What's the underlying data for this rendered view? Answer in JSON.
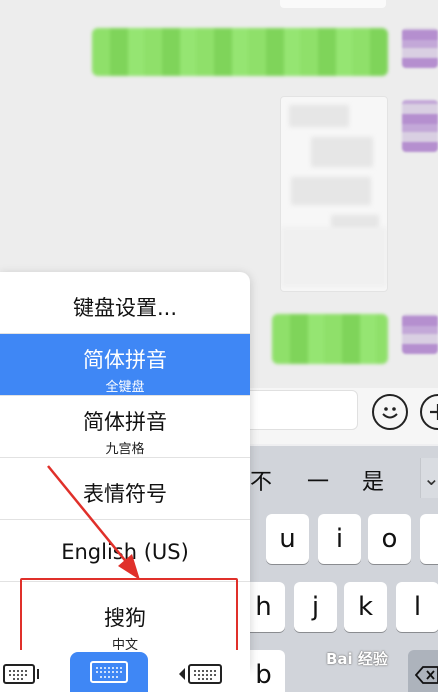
{
  "menu": {
    "items": [
      {
        "main": "键盘设置...",
        "sub": ""
      },
      {
        "main": "简体拼音",
        "sub": "全键盘",
        "selected": true
      },
      {
        "main": "简体拼音",
        "sub": "九宫格"
      },
      {
        "main": "表情符号",
        "sub": ""
      },
      {
        "main": "English (US)",
        "sub": ""
      },
      {
        "main": "搜狗",
        "sub": "中文"
      }
    ]
  },
  "keyboard": {
    "candidates": [
      "不",
      "一",
      "是"
    ],
    "row1": [
      "u",
      "i",
      "o"
    ],
    "row2": [
      "h",
      "j",
      "k",
      "l"
    ],
    "row3": [
      "b"
    ]
  },
  "input_bar": {
    "emoji_icon": "emoji-icon",
    "add_icon": "plus-icon"
  },
  "watermark": "Bai 经验",
  "colors": {
    "selected_bg": "#3f87f5",
    "highlight_border": "#e0302a",
    "bubble_green": "#95ec69"
  }
}
